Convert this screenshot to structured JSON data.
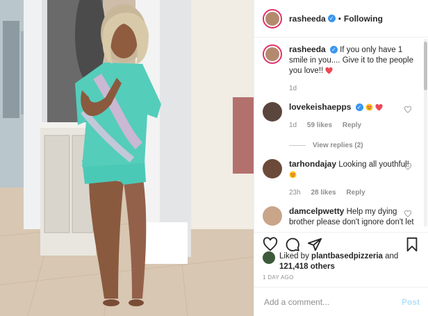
{
  "header": {
    "username": "rasheeda",
    "separator": "•",
    "follow_label": "Following"
  },
  "caption": {
    "username": "rasheeda",
    "text": "If you only have 1 smile in you.... Give it to the people you love!!",
    "age": "1d"
  },
  "comments": [
    {
      "username": "lovekeishaepps",
      "verified": true,
      "text": "",
      "emojis": [
        "smiling-heart-eyes",
        "red-heart"
      ],
      "age": "1d",
      "likes": "59 likes",
      "reply": "Reply",
      "view_replies": "View replies (2)"
    },
    {
      "username": "tarhondajay",
      "verified": false,
      "text": "Looking all youthful!",
      "emojis": [
        "smiling-heart-eyes"
      ],
      "age": "23h",
      "likes": "28 likes",
      "reply": "Reply"
    },
    {
      "username": "damcelpwetty",
      "verified": false,
      "text": "Help my dying brother please don't ignore don't let him die help needed for",
      "age": "",
      "likes": "",
      "reply": ""
    }
  ],
  "likes": {
    "prefix": "Liked by",
    "liker": "plantbasedpizzeria",
    "joiner": "and",
    "others": "121,418 others"
  },
  "time_ago": "1 DAY AGO",
  "add_comment": {
    "placeholder": "Add a comment...",
    "post_label": "Post"
  },
  "colors": {
    "accent": "#3897f0",
    "ring": "#e1306c",
    "heart": "#ed4956",
    "post_disabled": "#b2dffc"
  },
  "icons": [
    "heart-icon",
    "comment-icon",
    "share-icon",
    "bookmark-icon",
    "verified-icon"
  ]
}
